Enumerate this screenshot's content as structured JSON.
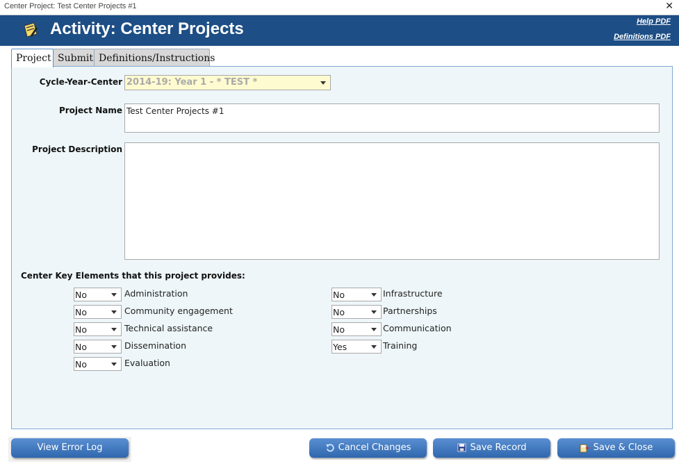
{
  "window": {
    "title": "Center Project: Test Center Projects #1",
    "close_label": "✕"
  },
  "header": {
    "title": "Activity: Center Projects",
    "help_link": "Help PDF",
    "definitions_link": "Definitions PDF"
  },
  "tabs": [
    {
      "label": "Project",
      "active": true
    },
    {
      "label": "Submit",
      "active": false
    },
    {
      "label": "Definitions/Instructions",
      "active": false
    }
  ],
  "form": {
    "cycle_label": "Cycle-Year-Center",
    "cycle_value": "2014-19: Year 1 - * TEST *",
    "project_name_label": "Project Name",
    "project_name_value": "Test Center Projects #1",
    "project_description_label": "Project Description",
    "project_description_value": ""
  },
  "key_elements": {
    "heading": "Center Key Elements that this project provides:",
    "left": [
      {
        "label": "Administration",
        "value": "No"
      },
      {
        "label": "Community engagement",
        "value": "No"
      },
      {
        "label": "Technical assistance",
        "value": "No"
      },
      {
        "label": "Dissemination",
        "value": "No"
      },
      {
        "label": "Evaluation",
        "value": "No"
      }
    ],
    "right": [
      {
        "label": "Infrastructure",
        "value": "No"
      },
      {
        "label": "Partnerships",
        "value": "No"
      },
      {
        "label": "Communication",
        "value": "No"
      },
      {
        "label": "Training",
        "value": "Yes"
      }
    ]
  },
  "footer": {
    "view_error_log": "View Error Log",
    "cancel_changes": "Cancel Changes",
    "save_record": "Save Record",
    "save_close": "Save & Close"
  },
  "colors": {
    "header_bg": "#1d4e85",
    "panel_bg": "#eef6f9",
    "button_top": "#5a8fd2",
    "button_bottom": "#2f67ad",
    "combo_bg": "#fffbd0"
  }
}
